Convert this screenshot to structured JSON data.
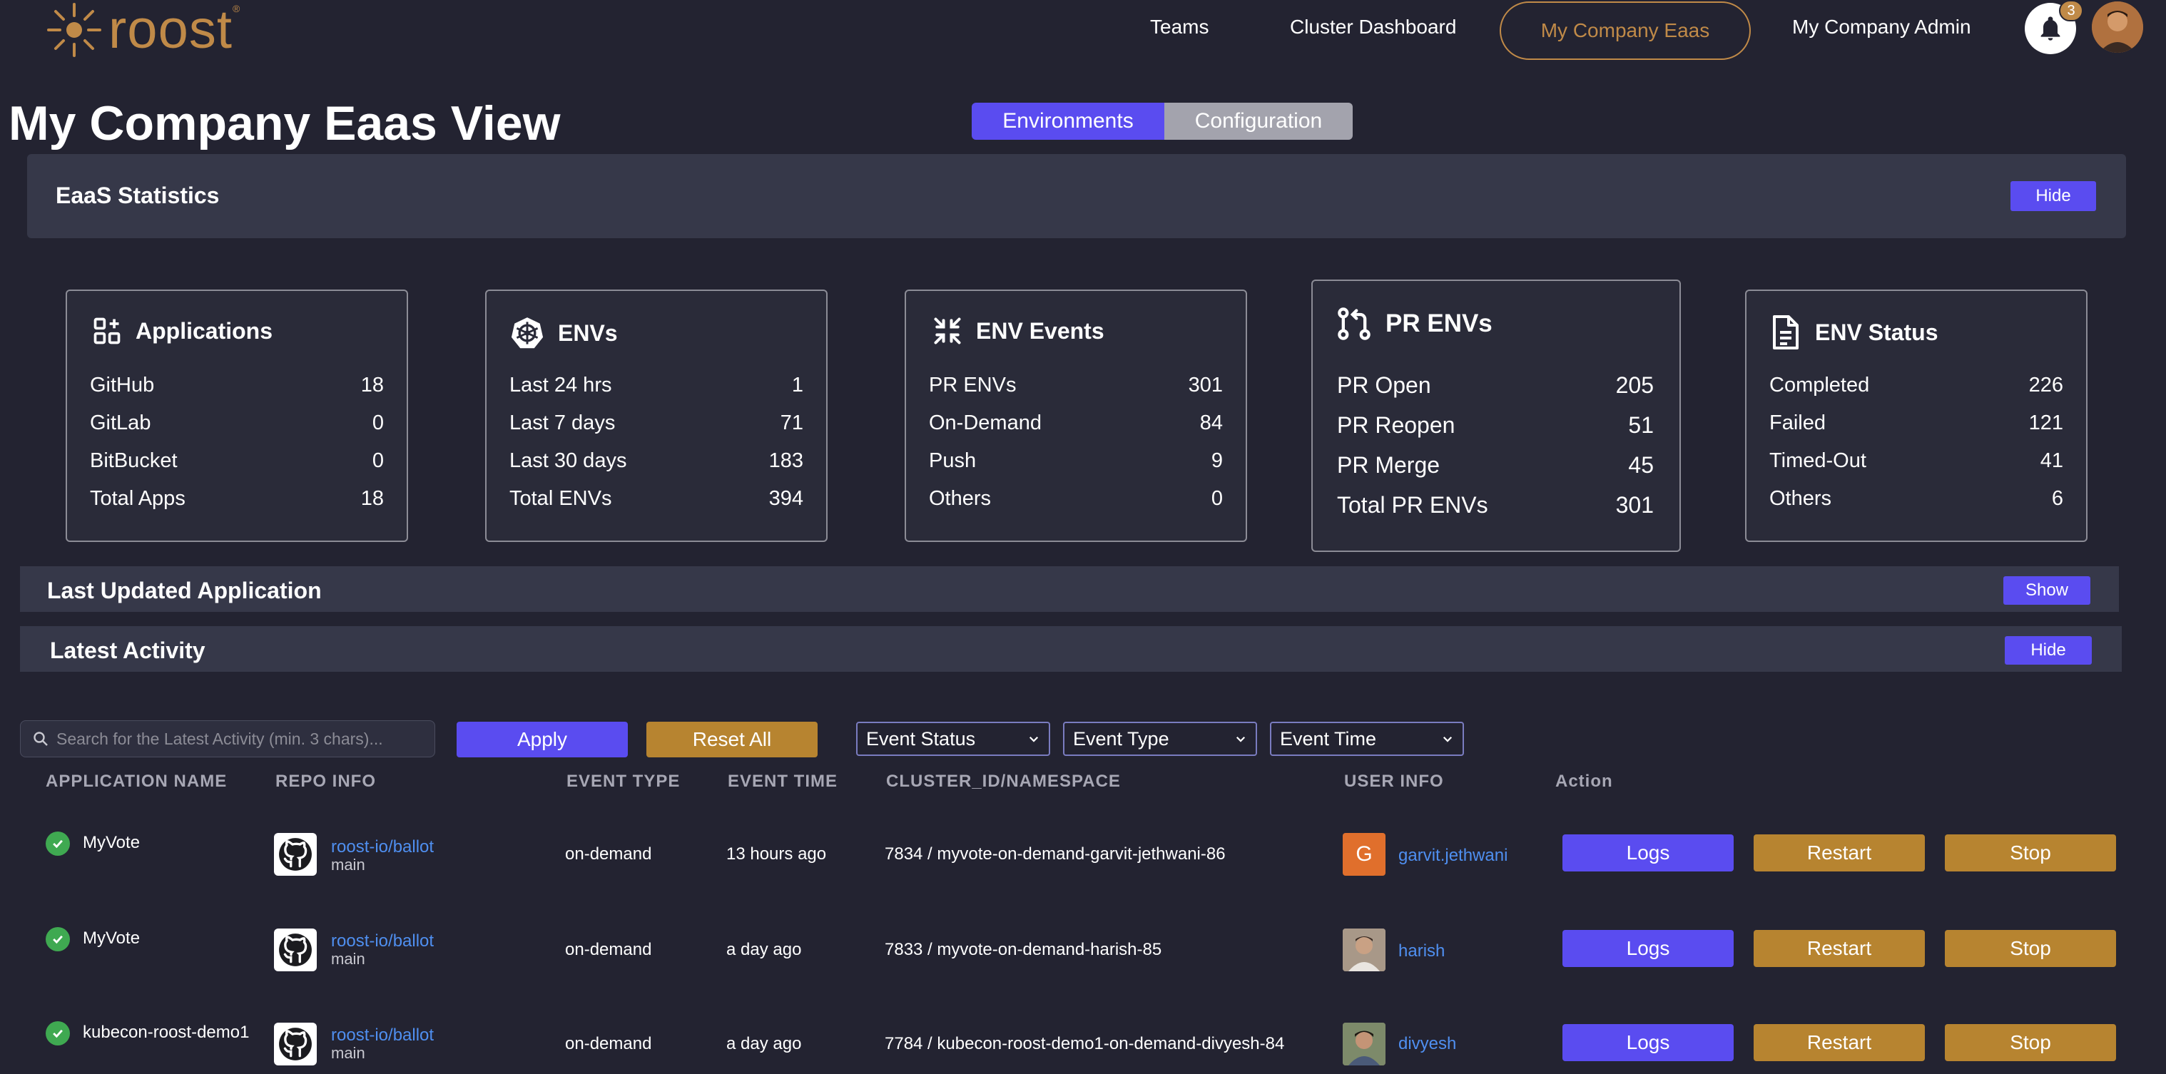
{
  "brand": {
    "name": "roost",
    "trademark": "®"
  },
  "nav": {
    "items": [
      "Teams",
      "Cluster Dashboard",
      "My Company Eaas",
      "My Company Admin"
    ],
    "active_index": 2,
    "notification_count": "3"
  },
  "page": {
    "title": "My Company Eaas View",
    "tabs": [
      "Environments",
      "Configuration"
    ],
    "active_tab": "Environments"
  },
  "stats_section": {
    "title": "EaaS Statistics",
    "toggle_label": "Hide"
  },
  "cards": [
    {
      "title": "Applications",
      "icon": "apps-icon",
      "rows": [
        {
          "label": "GitHub",
          "value": "18"
        },
        {
          "label": "GitLab",
          "value": "0"
        },
        {
          "label": "BitBucket",
          "value": "0"
        },
        {
          "label": "Total Apps",
          "value": "18"
        }
      ]
    },
    {
      "title": "ENVs",
      "icon": "kubernetes-icon",
      "rows": [
        {
          "label": "Last 24 hrs",
          "value": "1"
        },
        {
          "label": "Last 7 days",
          "value": "71"
        },
        {
          "label": "Last 30 days",
          "value": "183"
        },
        {
          "label": "Total ENVs",
          "value": "394"
        }
      ]
    },
    {
      "title": "ENV Events",
      "icon": "compress-icon",
      "rows": [
        {
          "label": "PR ENVs",
          "value": "301"
        },
        {
          "label": "On-Demand",
          "value": "84"
        },
        {
          "label": "Push",
          "value": "9"
        },
        {
          "label": "Others",
          "value": "0"
        }
      ]
    },
    {
      "title": "PR ENVs",
      "icon": "pull-request-icon",
      "rows": [
        {
          "label": "PR Open",
          "value": "205"
        },
        {
          "label": "PR Reopen",
          "value": "51"
        },
        {
          "label": "PR Merge",
          "value": "45"
        },
        {
          "label": "Total PR ENVs",
          "value": "301"
        }
      ]
    },
    {
      "title": "ENV Status",
      "icon": "document-icon",
      "rows": [
        {
          "label": "Completed",
          "value": "226"
        },
        {
          "label": "Failed",
          "value": "121"
        },
        {
          "label": "Timed-Out",
          "value": "41"
        },
        {
          "label": "Others",
          "value": "6"
        }
      ]
    }
  ],
  "last_updated_section": {
    "title": "Last Updated Application",
    "toggle_label": "Show"
  },
  "activity_section": {
    "title": "Latest Activity",
    "toggle_label": "Hide"
  },
  "filters": {
    "search_placeholder": "Search for the Latest Activity (min. 3 chars)...",
    "apply_label": "Apply",
    "reset_label": "Reset All",
    "dropdowns": [
      "Event Status",
      "Event Type",
      "Event Time"
    ]
  },
  "table": {
    "headers": [
      "APPLICATION NAME",
      "REPO INFO",
      "EVENT TYPE",
      "EVENT TIME",
      "CLUSTER_ID/NAMESPACE",
      "USER INFO",
      "Action"
    ],
    "actions": [
      "Logs",
      "Restart",
      "Stop"
    ],
    "rows": [
      {
        "app": "MyVote",
        "repo": "roost-io/ballot",
        "branch": "main",
        "event_type": "on-demand",
        "event_time": "13 hours ago",
        "cluster": "7834 / myvote-on-demand-garvit-jethwani-86",
        "user": "garvit.jethwani",
        "user_initial": "G"
      },
      {
        "app": "MyVote",
        "repo": "roost-io/ballot",
        "branch": "main",
        "event_type": "on-demand",
        "event_time": "a day ago",
        "cluster": "7833 / myvote-on-demand-harish-85",
        "user": "harish",
        "user_initial": ""
      },
      {
        "app": "kubecon-roost-demo1",
        "repo": "roost-io/ballot",
        "branch": "main",
        "event_type": "on-demand",
        "event_time": "a day ago",
        "cluster": "7784 / kubecon-roost-demo1-on-demand-divyesh-84",
        "user": "divyesh",
        "user_initial": ""
      }
    ]
  },
  "colors": {
    "background": "#232331",
    "accent": "#5a4cf0",
    "brand_gold": "#c08a48",
    "button_gold": "#b78430",
    "success": "#3fa951",
    "link": "#4f8ff0"
  }
}
